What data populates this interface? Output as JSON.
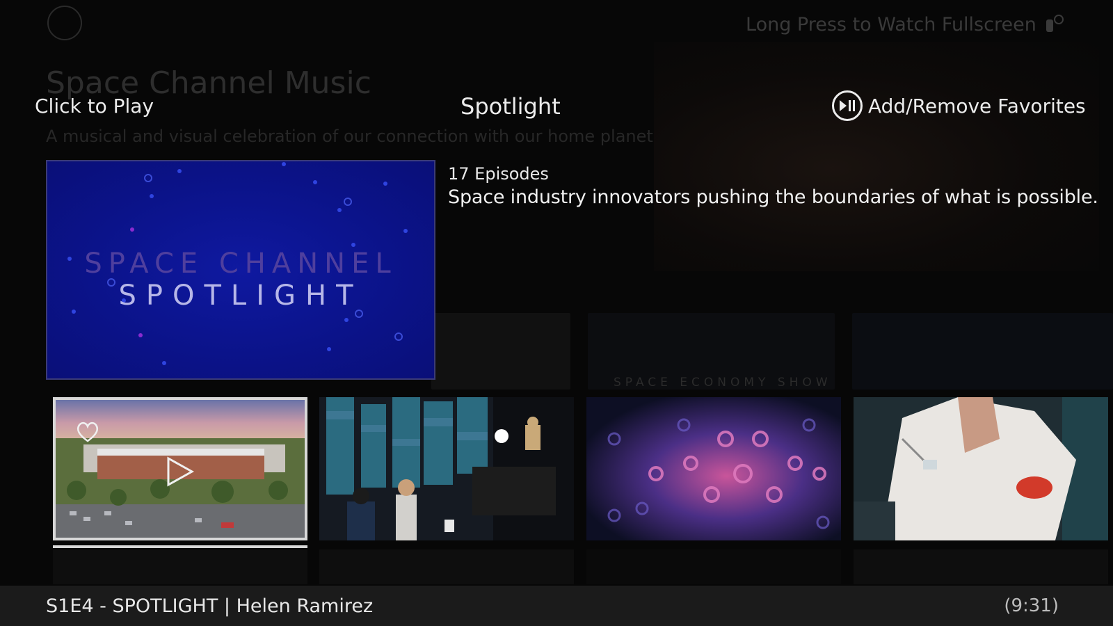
{
  "background": {
    "logo_text": "",
    "hint": "Long Press to Watch Fullscreen",
    "channel_title": "Space Channel Music",
    "channel_subtitle": "A musical and visual celebration of our connection with our home planet",
    "tile_label": "SPACE ECONOMY SHOW"
  },
  "header": {
    "click_to_play": "Click to Play",
    "title": "Spotlight",
    "favorites_label": "Add/Remove Favorites"
  },
  "hero": {
    "line1": "SPACE CHANNEL",
    "line2": "SPOTLIGHT"
  },
  "show": {
    "episodes": "17 Episodes",
    "description": "Space industry innovators pushing the boundaries of what is possible."
  },
  "thumbnails": [
    {
      "icon": "heart-icon",
      "overlay": "play-icon",
      "selected": true
    },
    {
      "selected": false
    },
    {
      "selected": false
    },
    {
      "selected": false
    }
  ],
  "footer": {
    "now_playing": "S1E4 - SPOTLIGHT | Helen Ramirez",
    "duration": "(9:31)"
  },
  "colors": {
    "hero_bg": "#0b138a",
    "accent_text": "#ececec",
    "footer_bg": "#1b1b1b"
  }
}
